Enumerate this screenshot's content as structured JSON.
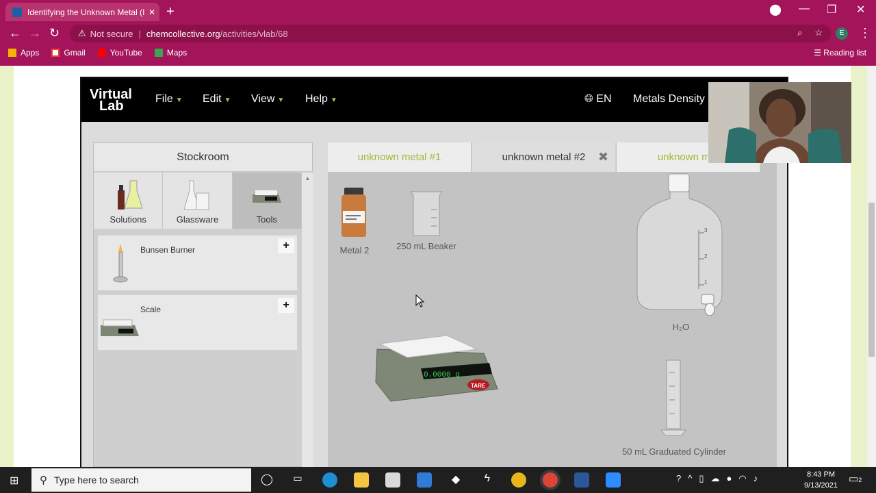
{
  "browser": {
    "tab_title": "Identifying the Unknown Metal (I",
    "tab_close": "✕",
    "new_tab": "+",
    "window_controls": {
      "minimize": "—",
      "maximize": "❐",
      "close": "✕"
    },
    "address": {
      "not_secure": "Not secure",
      "separator": "|",
      "domain": "chemcollective.org",
      "path": "/activities/vlab/68"
    },
    "profile_initial": "E",
    "bookmarks": [
      {
        "label": "Apps",
        "icon": "apps-grid-icon",
        "color": "#f4b400"
      },
      {
        "label": "Gmail",
        "icon": "gmail-icon",
        "color": "#ea4335"
      },
      {
        "label": "YouTube",
        "icon": "youtube-icon",
        "color": "#ff0000"
      },
      {
        "label": "Maps",
        "icon": "maps-icon",
        "color": "#34a853"
      }
    ],
    "reading_list": "Reading list",
    "theme_color": "#a3145a"
  },
  "vlab": {
    "logo_line1": "Virtual",
    "logo_line2": "Lab",
    "menus": [
      "File",
      "Edit",
      "View",
      "Help"
    ],
    "language": "EN",
    "activity_title": "Metals Density P",
    "stockroom": {
      "title": "Stockroom",
      "tabs": [
        {
          "label": "Solutions",
          "active": false
        },
        {
          "label": "Glassware",
          "active": false
        },
        {
          "label": "Tools",
          "active": true
        }
      ],
      "items": [
        {
          "name": "Bunsen Burner",
          "add": "+"
        },
        {
          "name": "Scale",
          "add": "+"
        }
      ]
    },
    "workbench": {
      "tabs": [
        {
          "label": "unknown metal #1",
          "active": false
        },
        {
          "label": "unknown metal #2",
          "active": true,
          "close": "✖"
        },
        {
          "label": "unknown met",
          "active": false
        }
      ],
      "items": {
        "metal": "Metal 2",
        "beaker": "250 mL Beaker",
        "water": "H₂O",
        "scale_reading": "0.0000 g",
        "tare": "TARE",
        "cylinder": "50 mL Graduated Cylinder"
      },
      "carboy_scale": [
        "3",
        "2",
        "1"
      ]
    }
  },
  "taskbar": {
    "search_placeholder": "Type here to search",
    "time": "8:43 PM",
    "date": "9/13/2021",
    "notifications": "2"
  }
}
